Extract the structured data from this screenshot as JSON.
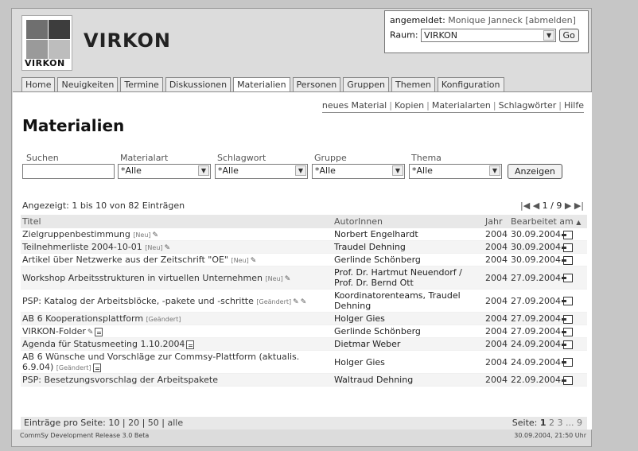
{
  "brand": {
    "logo_text": "VIRKON",
    "title": "VIRKON"
  },
  "login": {
    "logged_in_label": "angemeldet:",
    "user": "Monique Janneck",
    "logout": "[abmelden]",
    "room_label": "Raum:",
    "room_value": "VIRKON",
    "go": "Go"
  },
  "tabs": [
    "Home",
    "Neuigkeiten",
    "Termine",
    "Diskussionen",
    "Materialien",
    "Personen",
    "Gruppen",
    "Themen",
    "Konfiguration"
  ],
  "active_tab": "Materialien",
  "actions": [
    "neues Material",
    "Kopien",
    "Materialarten",
    "Schlagwörter",
    "Hilfe"
  ],
  "heading": "Materialien",
  "filters": {
    "search_label": "Suchen",
    "search_value": "",
    "type_label": "Materialart",
    "type_value": "*Alle",
    "keyword_label": "Schlagwort",
    "keyword_value": "*Alle",
    "group_label": "Gruppe",
    "group_value": "*Alle",
    "topic_label": "Thema",
    "topic_value": "*Alle",
    "submit": "Anzeigen"
  },
  "info": "Angezeigt: 1 bis 10 von 82 Einträgen",
  "pager_top": "1 / 9",
  "columns": {
    "title": "Titel",
    "author": "AutorInnen",
    "year": "Jahr",
    "edited": "Bearbeitet am"
  },
  "rows": [
    {
      "title": "Zielgruppenbestimmung",
      "tag": "[Neu]",
      "author": "Norbert Engelhardt",
      "year": "2004",
      "date": "30.09.2004"
    },
    {
      "title": "Teilnehmerliste 2004-10-01",
      "tag": "[Neu]",
      "author": "Traudel Dehning",
      "year": "2004",
      "date": "30.09.2004"
    },
    {
      "title": "Artikel über Netzwerke aus der Zeitschrift \"OE\"",
      "tag": "[Neu]",
      "author": "Gerlinde Schönberg",
      "year": "2004",
      "date": "30.09.2004"
    },
    {
      "title": "Workshop Arbeitsstrukturen in virtuellen Unternehmen",
      "tag": "[Neu]",
      "author": "Prof. Dr. Hartmut Neuendorf / Prof. Dr. Bernd Ott",
      "year": "2004",
      "date": "27.09.2004"
    },
    {
      "title": "PSP: Katalog der Arbeitsblöcke, -pakete und -schritte",
      "tag": "[Geändert]",
      "author": "Koordinatorenteams, Traudel Dehning",
      "year": "2004",
      "date": "27.09.2004"
    },
    {
      "title": "AB 6 Kooperationsplattform",
      "tag": "[Geändert]",
      "author": "Holger Gies",
      "year": "2004",
      "date": "27.09.2004"
    },
    {
      "title": "VIRKON-Folder",
      "tag": "",
      "author": "Gerlinde Schönberg",
      "year": "2004",
      "date": "27.09.2004"
    },
    {
      "title": "Agenda für Statusmeeting 1.10.2004",
      "tag": "",
      "author": "Dietmar Weber",
      "year": "2004",
      "date": "24.09.2004"
    },
    {
      "title": "AB 6 Wünsche und Vorschläge zur Commsy-Plattform (aktualis. 6.9.04)",
      "tag": "[Geändert]",
      "author": "Holger Gies",
      "year": "2004",
      "date": "24.09.2004"
    },
    {
      "title": "PSP: Besetzungsvorschlag der Arbeitspakete",
      "tag": "",
      "author": "Waltraud Dehning",
      "year": "2004",
      "date": "22.09.2004"
    }
  ],
  "per_page": {
    "label": "Einträge pro Seite:",
    "options": [
      "10",
      "20",
      "50",
      "alle"
    ]
  },
  "pages": {
    "label": "Seite:",
    "current": "1",
    "others": "2 3 ... 9"
  },
  "status": {
    "left": "CommSy Development Release 3.0 Beta",
    "right": "30.09.2004, 21:50 Uhr"
  }
}
